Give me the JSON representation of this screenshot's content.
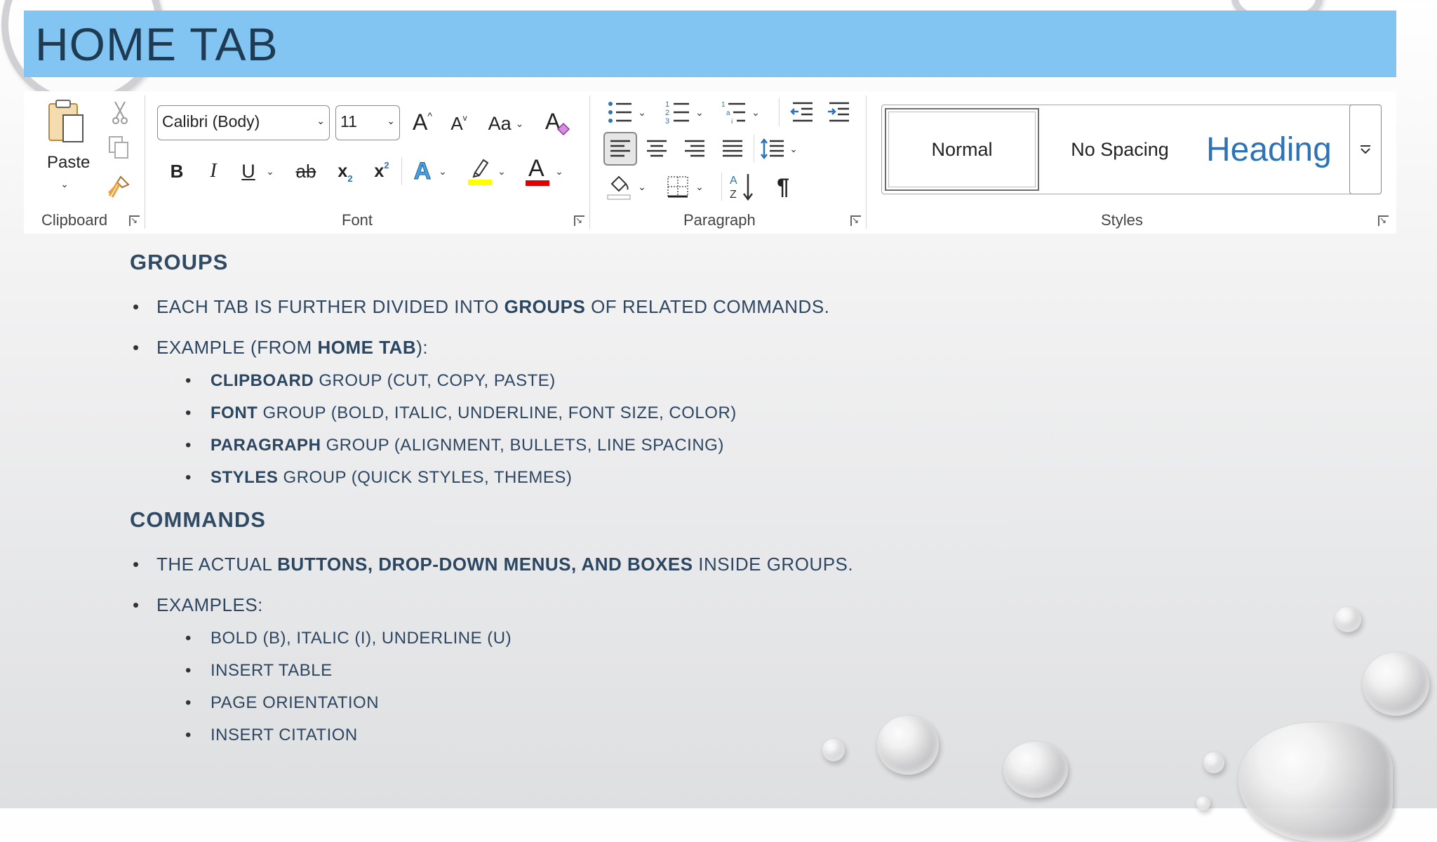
{
  "slide": {
    "title": "HOME TAB"
  },
  "ribbon": {
    "clipboard": {
      "paste_label": "Paste",
      "group_label": "Clipboard",
      "icons": [
        "clipboard-icon",
        "scissors-icon",
        "copy-icon",
        "format-painter-icon"
      ]
    },
    "font": {
      "font_name": "Calibri (Body)",
      "font_size": "11",
      "grow_label": "A",
      "shrink_label": "A",
      "case_label": "Aa",
      "bold_label": "B",
      "italic_label": "I",
      "underline_label": "U",
      "strike_label": "ab",
      "subscript_label": "x",
      "superscript_label": "x",
      "effects_label": "A",
      "color_label": "A",
      "group_label": "Font",
      "highlight_color": "#ffff00",
      "font_color": "#e00000"
    },
    "paragraph": {
      "group_label": "Paragraph",
      "sort_label": "A Z",
      "pilcrow": "¶"
    },
    "styles": {
      "normal": "Normal",
      "no_spacing": "No Spacing",
      "heading": "Heading",
      "group_label": "Styles"
    }
  },
  "body": {
    "groups_heading": "GROUPS",
    "groups_bullet1_a": "EACH TAB IS FURTHER DIVIDED INTO ",
    "groups_bullet1_b": "GROUPS",
    "groups_bullet1_c": " OF RELATED COMMANDS.",
    "groups_bullet2_a": "EXAMPLE (FROM ",
    "groups_bullet2_b": "HOME TAB",
    "groups_bullet2_c": "):",
    "groups_examples": [
      {
        "bold": "CLIPBOARD",
        "rest": " GROUP (CUT, COPY, PASTE)"
      },
      {
        "bold": "FONT",
        "rest": " GROUP (BOLD, ITALIC, UNDERLINE, FONT SIZE, COLOR)"
      },
      {
        "bold": "PARAGRAPH",
        "rest": " GROUP (ALIGNMENT, BULLETS, LINE SPACING)"
      },
      {
        "bold": "STYLES",
        "rest": " GROUP (QUICK STYLES, THEMES)"
      }
    ],
    "commands_heading": "COMMANDS",
    "commands_bullet1_a": "THE ACTUAL ",
    "commands_bullet1_b": "BUTTONS, DROP-DOWN MENUS, AND BOXES",
    "commands_bullet1_c": " INSIDE GROUPS.",
    "commands_bullet2": "EXAMPLES:",
    "commands_examples": [
      "BOLD (B), ITALIC (I), UNDERLINE (U)",
      "INSERT TABLE",
      "PAGE ORIENTATION",
      "INSERT CITATION"
    ]
  },
  "colors": {
    "title_bar": "#82c5f2",
    "title_text": "#1f3b53",
    "body_text": "#2d4661",
    "heading_style": "#2e74b5"
  }
}
